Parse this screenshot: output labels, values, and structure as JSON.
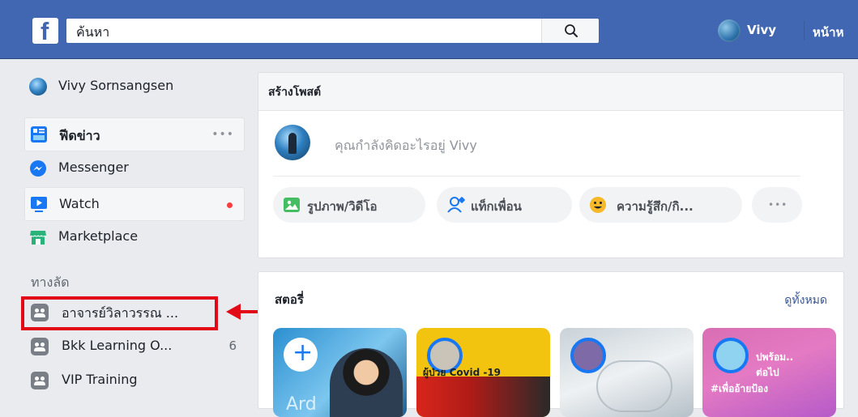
{
  "header": {
    "search_placeholder": "ค้นหา",
    "user_name": "Vivy",
    "home_label": "หน้าห"
  },
  "sidebar": {
    "profile_name": "Vivy Sornsangsen",
    "items": [
      {
        "label": "ฟีดข่าว",
        "more": "•••"
      },
      {
        "label": "Messenger"
      },
      {
        "label": "Watch"
      },
      {
        "label": "Marketplace"
      }
    ],
    "shortcuts_title": "ทางลัด",
    "shortcuts": [
      {
        "label": "อาจารย์วิลาวรรณ ..."
      },
      {
        "label": "Bkk Learning O...",
        "count": "6"
      },
      {
        "label": "VIP Training"
      }
    ]
  },
  "composer": {
    "title": "สร้างโพสต์",
    "placeholder": "คุณกำลังคิดอะไรอยู่ Vivy",
    "actions": [
      {
        "label": "รูปภาพ/วิดีโอ"
      },
      {
        "label": "แท็กเพื่อน"
      },
      {
        "label": "ความรู้สึก/กิ..."
      },
      {
        "label": "•••"
      }
    ]
  },
  "stories": {
    "title": "สตอรี่",
    "see_all": "ดูทั้งหมด",
    "cards": [
      {
        "add_symbol": "+",
        "caption": "Ard"
      },
      {
        "caption": "ผู้ป่วย Covid -19"
      },
      {
        "caption": ""
      },
      {
        "caption_line1": "ปพร้อม..",
        "caption_line2": "ต่อไป",
        "caption_line3": "#เพื่ออ้ายป้อง"
      }
    ]
  },
  "colors": {
    "brand": "#4267b2",
    "highlight": "#e30a17",
    "badge": "#fa3e3e"
  }
}
